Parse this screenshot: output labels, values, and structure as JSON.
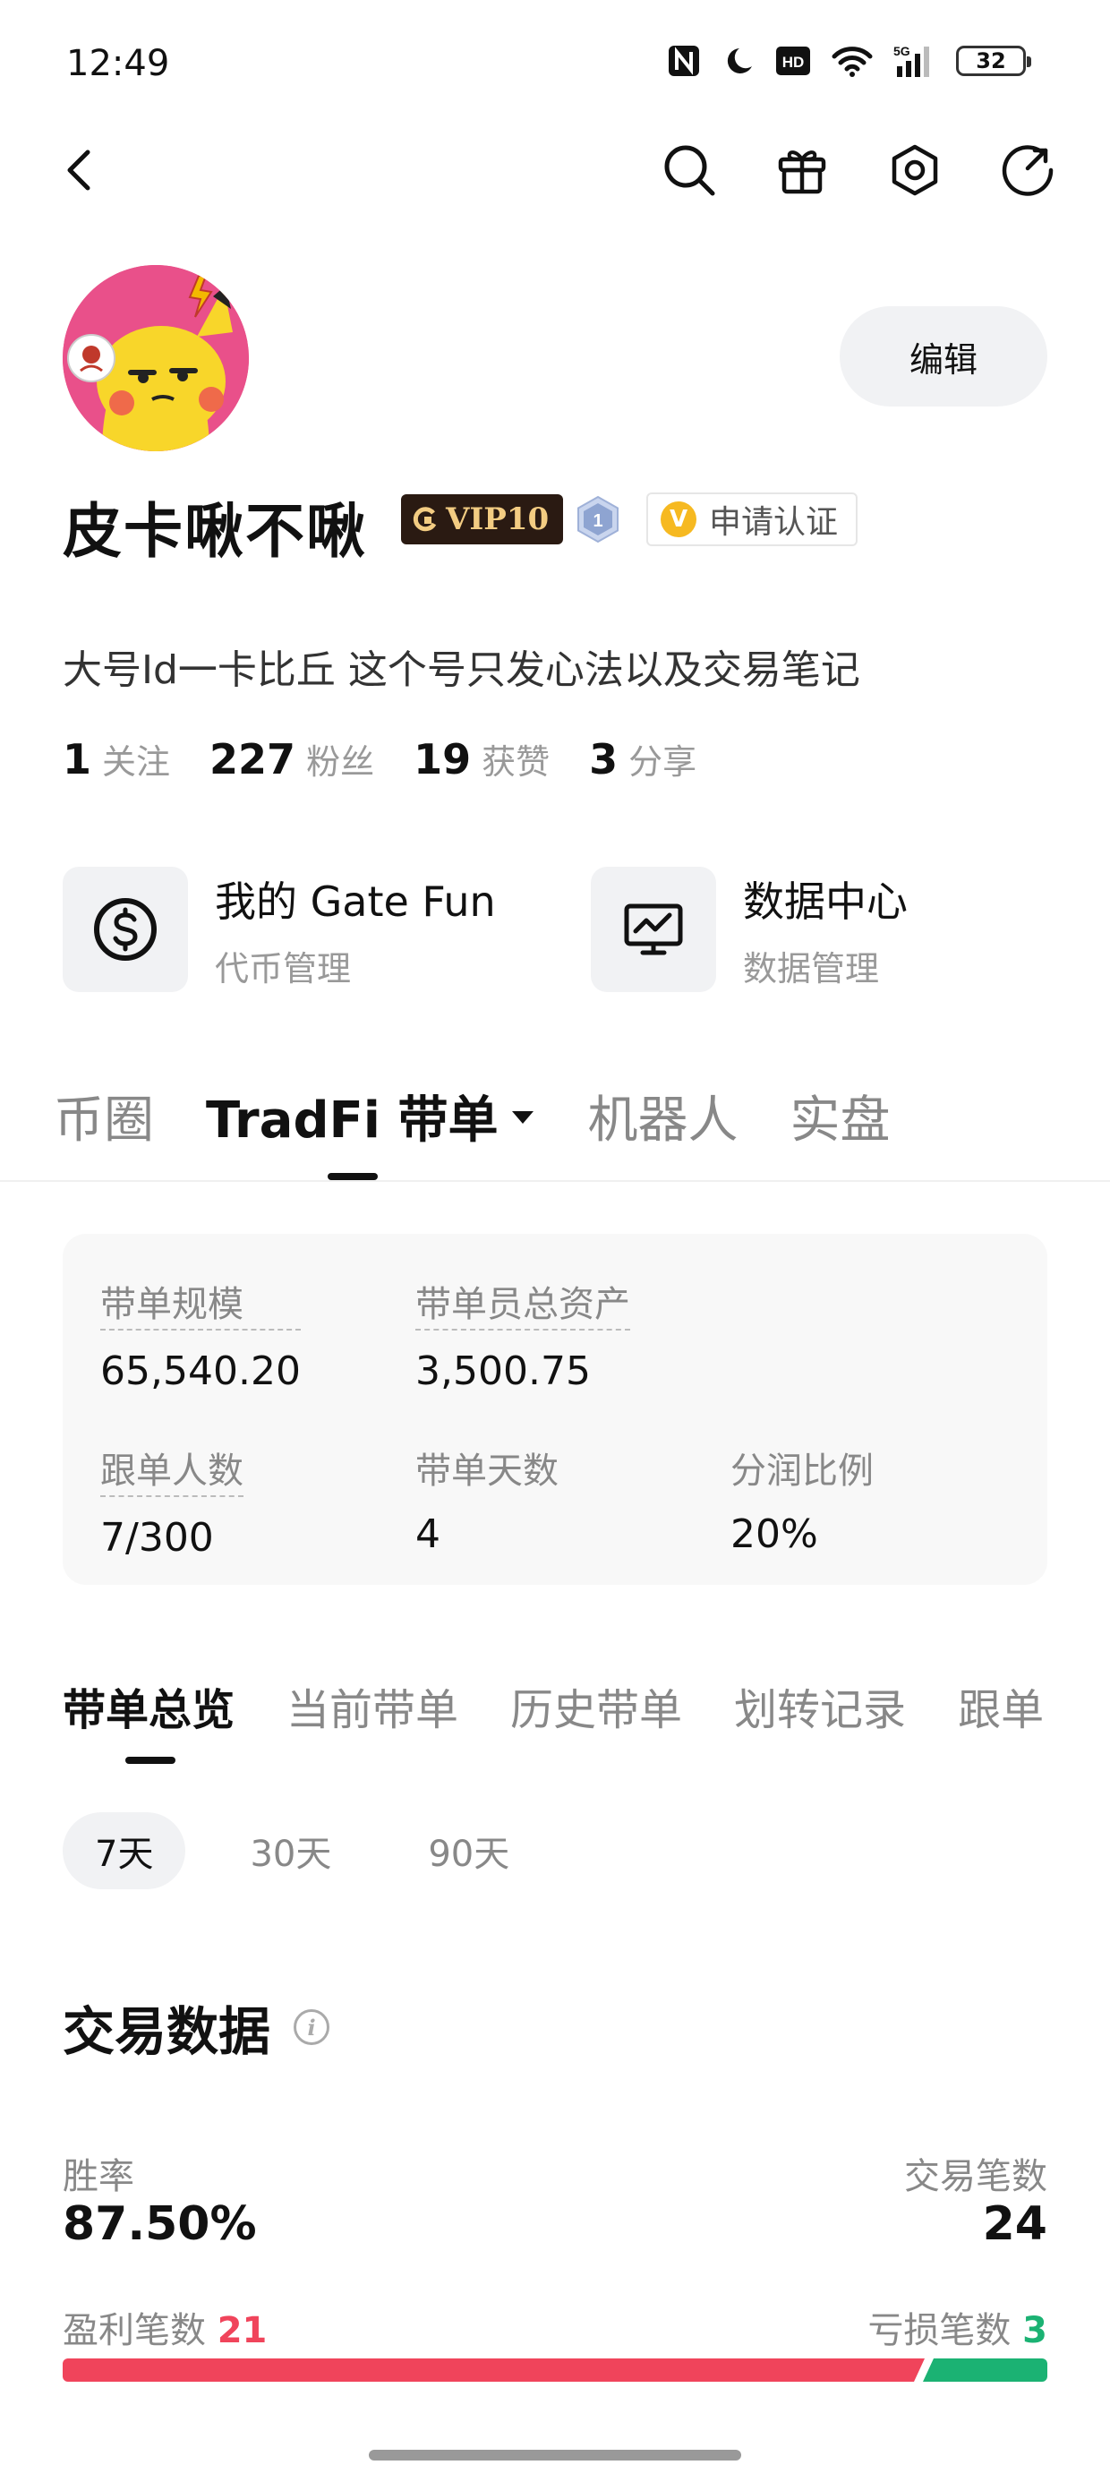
{
  "status_bar": {
    "time": "12:49",
    "battery": "32",
    "signal": "5G"
  },
  "profile": {
    "name": "皮卡啾不啾",
    "vip": "VIP10",
    "level": "1",
    "verify_label": "申请认证",
    "edit_label": "编辑",
    "bio": "大号Id一卡比丘 这个号只发心法以及交易笔记",
    "stats": [
      {
        "num": "1",
        "label": "关注"
      },
      {
        "num": "227",
        "label": "粉丝"
      },
      {
        "num": "19",
        "label": "获赞"
      },
      {
        "num": "3",
        "label": "分享"
      }
    ]
  },
  "shortcuts": [
    {
      "title": "我的 Gate Fun",
      "sub": "代币管理",
      "icon": "dollar-icon"
    },
    {
      "title": "数据中心",
      "sub": "数据管理",
      "icon": "chart-monitor-icon"
    }
  ],
  "main_tabs": [
    "币圈",
    "TradFi 带单",
    "机器人",
    "实盘"
  ],
  "copy_stats": {
    "scale_label": "带单规模",
    "scale_value": "65,540.20",
    "assets_label": "带单员总资产",
    "assets_value": "3,500.75",
    "followers_label": "跟单人数",
    "followers_value": "7/300",
    "days_label": "带单天数",
    "days_value": "4",
    "share_label": "分润比例",
    "share_value": "20%"
  },
  "sub_tabs": [
    "带单总览",
    "当前带单",
    "历史带单",
    "划转记录",
    "跟单"
  ],
  "periods": [
    "7天",
    "30天",
    "90天"
  ],
  "trade": {
    "title": "交易数据",
    "win_rate_label": "胜率",
    "win_rate": "87.50%",
    "trades_label": "交易笔数",
    "trades": "24",
    "profit_label": "盈利笔数",
    "profit": "21",
    "loss_label": "亏损笔数",
    "loss": "3",
    "profit_color": "#f0445b",
    "loss_color": "#1bb273"
  }
}
